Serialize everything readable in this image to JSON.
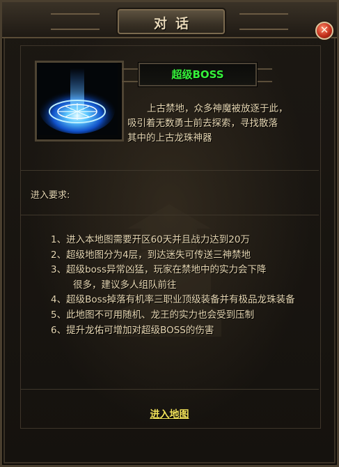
{
  "dialog": {
    "title": "对话",
    "close_symbol": "✕"
  },
  "boss": {
    "name": "超级BOSS",
    "portrait_icon": "blue-portal-icon",
    "description_lines": [
      "上古禁地，众多神魔被放逐于此，",
      "吸引着无数勇士前去探索，寻找散落",
      "其中的上古龙珠神器"
    ]
  },
  "requirements": {
    "label": "进入要求:",
    "items": [
      "1、进入本地图需要开区60天并且战力达到20万",
      "2、超级地图分为4层，到达迷失可传送三神禁地",
      "3、超级boss异常凶猛，玩家在禁地中的实力会下降",
      "很多，建议多人组队前往",
      "4、超级Boss掉落有机率三职业顶级装备并有极品龙珠装备",
      "5、此地图不可用随机、龙王的实力也会受到压制",
      "6、提升龙佑可增加对超级BOSS的伤害"
    ]
  },
  "actions": {
    "enter_label": "进入地图"
  },
  "colors": {
    "text": "#e7d7b3",
    "boss_name": "#35f23a",
    "link": "#f2e35a",
    "close": "#c2301c"
  }
}
